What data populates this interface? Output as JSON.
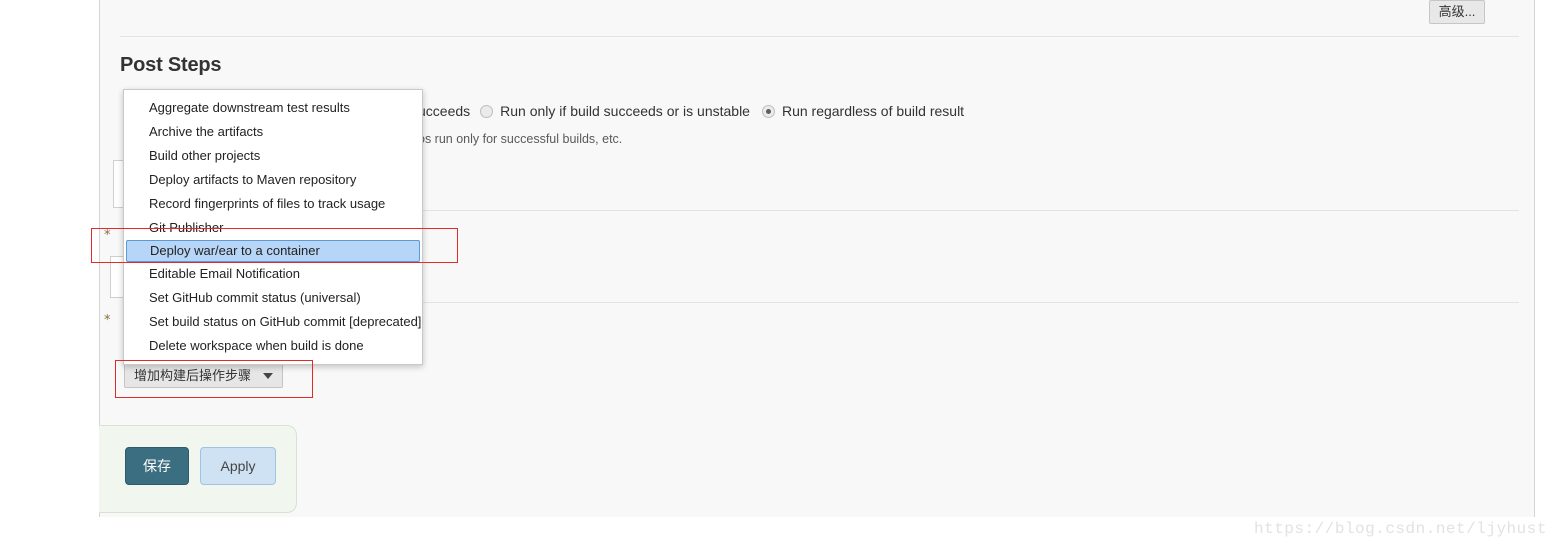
{
  "page": {
    "section_title": "Post Steps",
    "watermark": "https://blog.csdn.net/ljyhust"
  },
  "toolbar": {
    "advanced_label": "高级..."
  },
  "trigger_options": {
    "leading_fragment": "ucceeds",
    "options": [
      {
        "label": "Run only if build succeeds or is unstable",
        "checked": false
      },
      {
        "label": "Run regardless of build result",
        "checked": true
      }
    ],
    "help_text": "os run only for successful builds, etc."
  },
  "dropdown_menu": {
    "items": [
      {
        "label": "Aggregate downstream test results",
        "selected": false
      },
      {
        "label": "Archive the artifacts",
        "selected": false
      },
      {
        "label": "Build other projects",
        "selected": false
      },
      {
        "label": "Deploy artifacts to Maven repository",
        "selected": false
      },
      {
        "label": "Record fingerprints of files to track usage",
        "selected": false
      },
      {
        "label": "Git Publisher",
        "selected": false
      },
      {
        "label": "Deploy war/ear to a container",
        "selected": true
      },
      {
        "label": "Editable Email Notification",
        "selected": false
      },
      {
        "label": "Set GitHub commit status (universal)",
        "selected": false
      },
      {
        "label": "Set build status on GitHub commit [deprecated]",
        "selected": false
      },
      {
        "label": "Delete workspace when build is done",
        "selected": false
      }
    ]
  },
  "add_step": {
    "label": "增加构建后操作步骤"
  },
  "actions": {
    "save_label": "保存",
    "apply_label": "Apply"
  },
  "colors": {
    "highlight_fill": "#b6d5f7",
    "highlight_border": "#5a9ad8",
    "annotation_red": "#e02b2b",
    "save_button": "#3c6e82",
    "apply_button": "#cfe2f3",
    "save_bar_bg": "#f1f6ef"
  }
}
